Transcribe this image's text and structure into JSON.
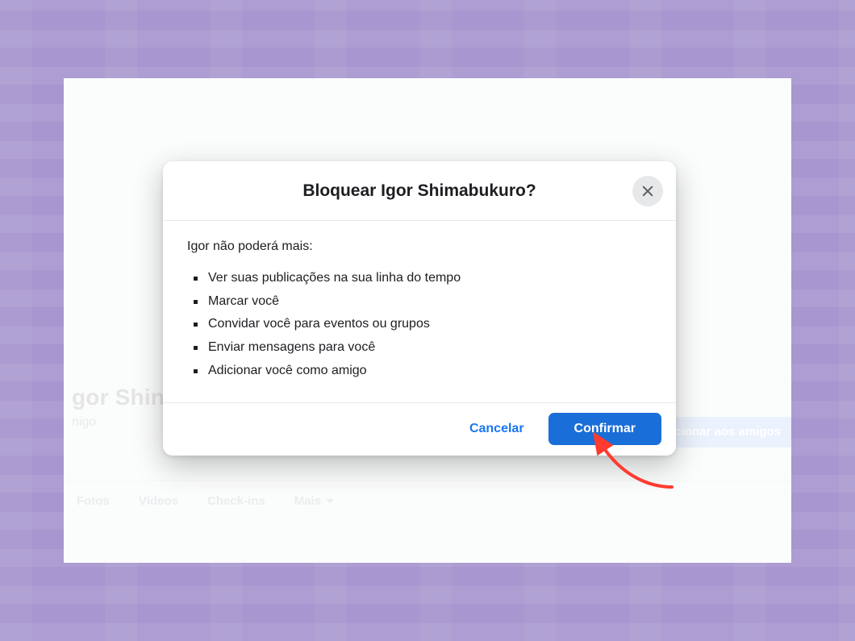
{
  "profile": {
    "name_partial": "gor Shin",
    "sub_partial": "nigo",
    "friend_button_partial": "cionar aos amigos"
  },
  "tabs": {
    "photos": "Fotos",
    "videos": "Vídeos",
    "checkins": "Check-ins",
    "more": "Mais"
  },
  "modal": {
    "title": "Bloquear Igor Shimabukuro?",
    "close_icon": "close",
    "lead": "Igor não poderá mais:",
    "items": [
      "Ver suas publicações na sua linha do tempo",
      "Marcar você",
      "Convidar você para eventos ou grupos",
      "Enviar mensagens para você",
      "Adicionar você como amigo"
    ],
    "cancel_label": "Cancelar",
    "confirm_label": "Confirmar"
  },
  "colors": {
    "outer_bg": "#a796cf",
    "inner_bg": "#f1f3f4",
    "primary_blue": "#1a6ed8",
    "link_blue": "#1877f2",
    "close_bg": "#e7e8ea",
    "accent_red": "#ff3b30"
  }
}
